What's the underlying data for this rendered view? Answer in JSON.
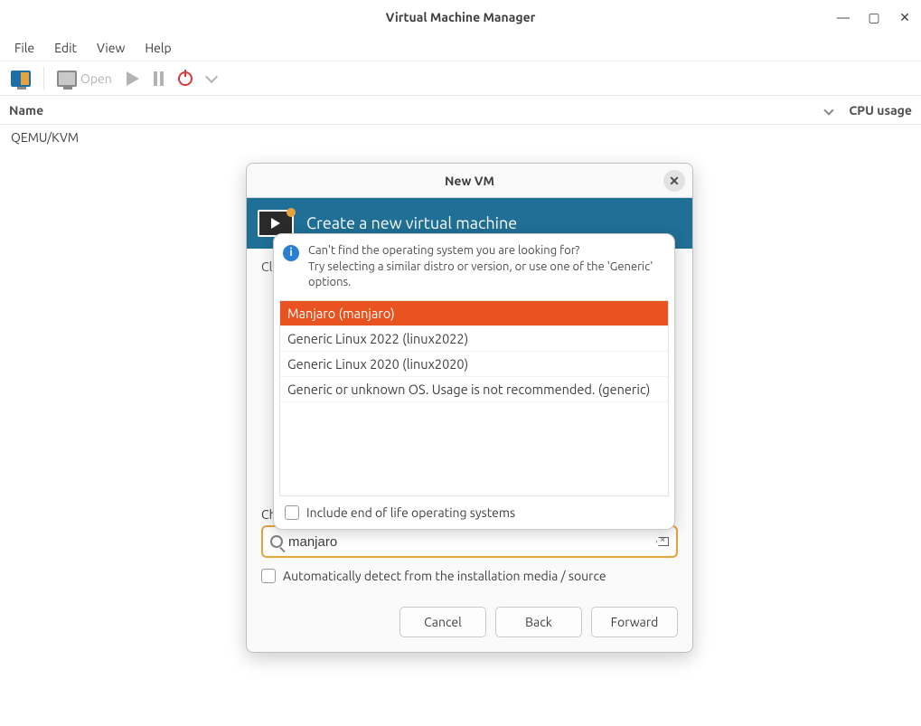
{
  "window": {
    "title": "Virtual Machine Manager"
  },
  "menu": {
    "file": "File",
    "edit": "Edit",
    "view": "View",
    "help": "Help"
  },
  "toolbar": {
    "open": "Open"
  },
  "columns": {
    "name": "Name",
    "cpu": "CPU usage"
  },
  "connections": {
    "qemu": "QEMU/KVM"
  },
  "dialog": {
    "title": "New VM",
    "banner": "Create a new virtual machine",
    "choose_partial_left": "Cl",
    "choose_os_label": "Choose the operating system you are installing:",
    "choose_os_partial": "Choose the operating system you        installing.",
    "search_value": "manjaro",
    "auto_detect": "Automatically detect from the installation media / source",
    "cancel": "Cancel",
    "back": "Back",
    "forward": "Forward"
  },
  "popover": {
    "hint_line1": "Can't find the operating system you are looking for?",
    "hint_line2": "Try selecting a similar distro or version, or use one of the 'Generic' options.",
    "items": [
      "Manjaro (manjaro)",
      "Generic Linux 2022 (linux2022)",
      "Generic Linux 2020 (linux2020)",
      "Generic or unknown OS. Usage is not recommended. (generic)"
    ],
    "include_eol": "Include end of life operating systems"
  }
}
